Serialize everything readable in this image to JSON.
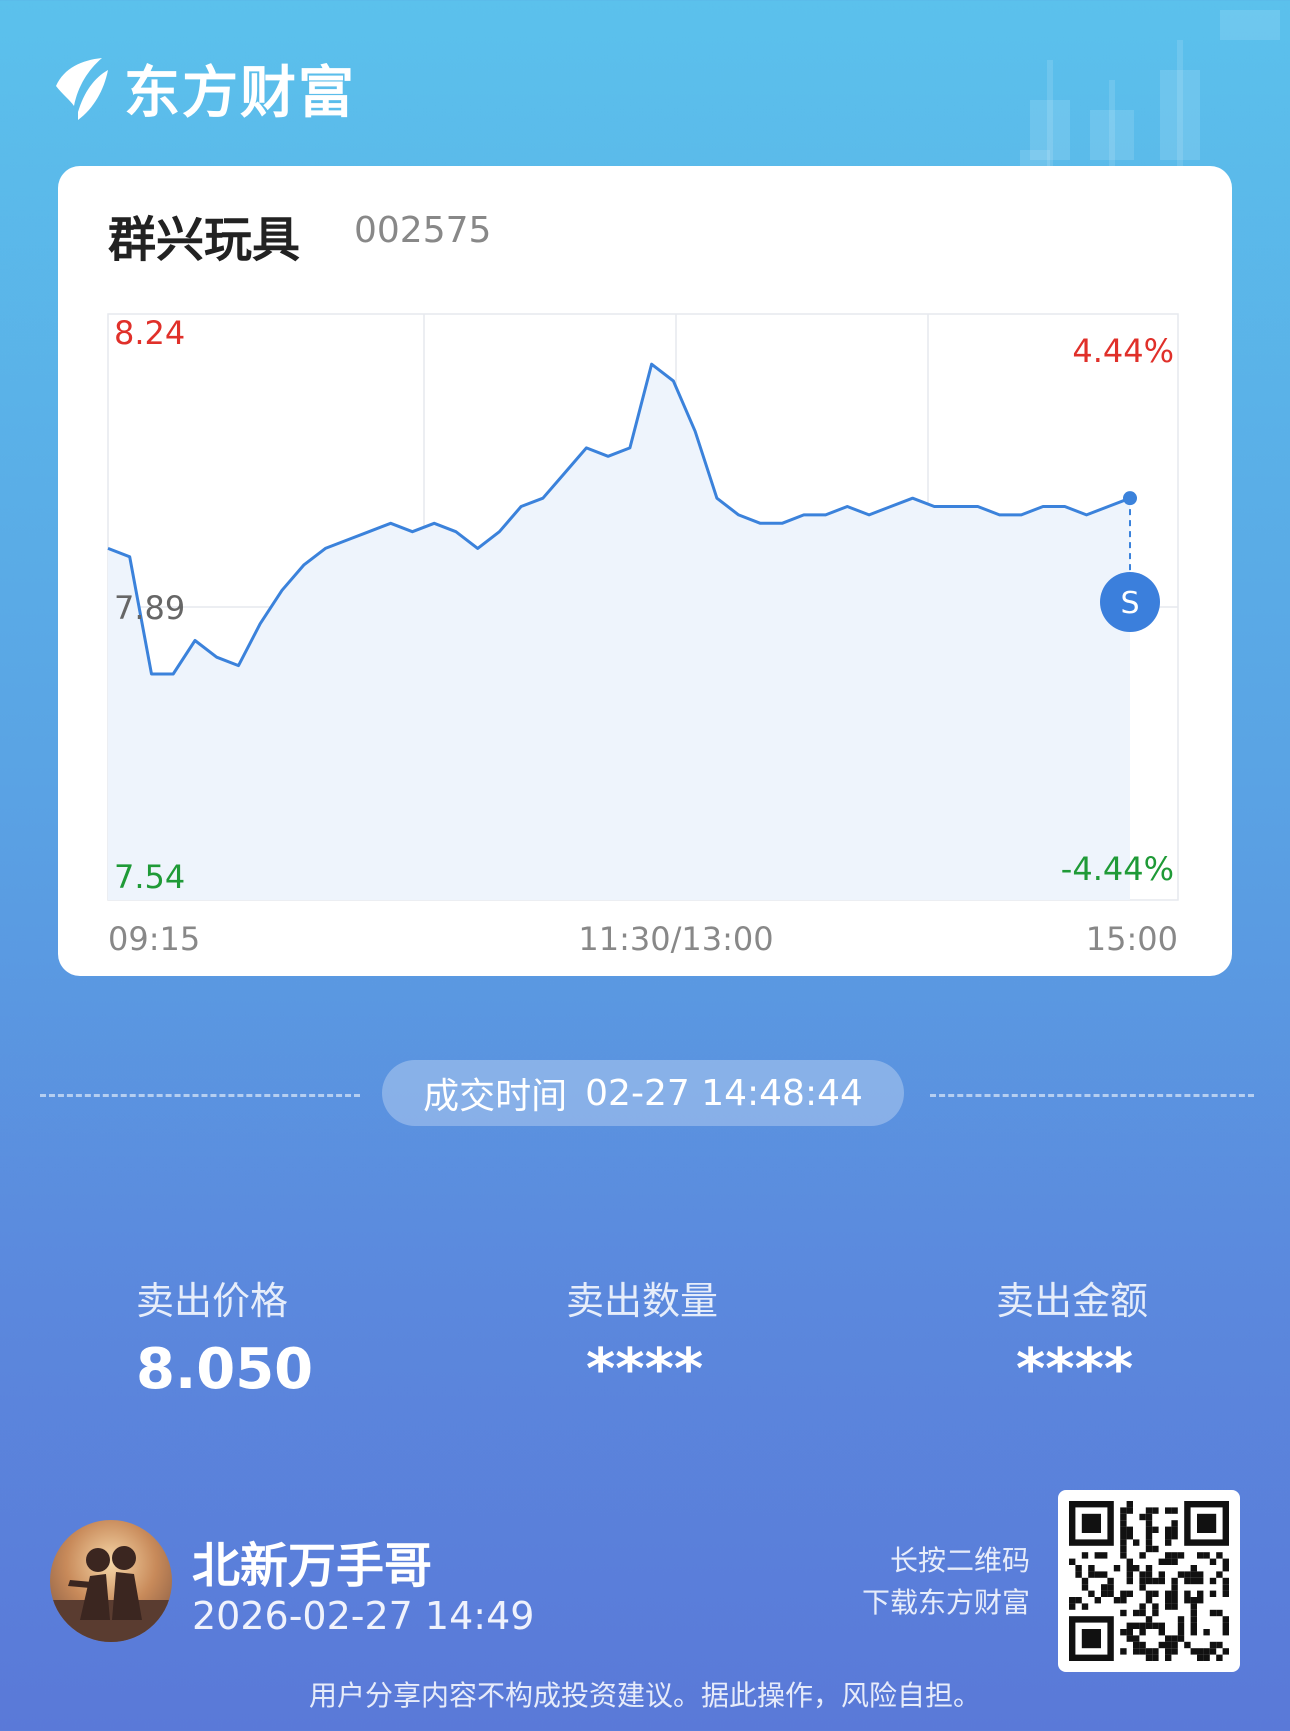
{
  "app": {
    "brand": "东方财富"
  },
  "stock": {
    "name": "群兴玩具",
    "code": "002575"
  },
  "chart_data": {
    "type": "line",
    "title": "",
    "price_high": "8.24",
    "price_base": "7.89",
    "price_low": "7.54",
    "pct_high": "4.44%",
    "pct_low": "-4.44%",
    "x_ticks": [
      "09:15",
      "11:30/13:00",
      "15:00"
    ],
    "ylim": [
      7.54,
      8.24
    ],
    "sell_marker_label": "S",
    "x": [
      "09:30",
      "09:35",
      "09:40",
      "09:45",
      "09:50",
      "09:55",
      "10:00",
      "10:05",
      "10:10",
      "10:15",
      "10:20",
      "10:25",
      "10:30",
      "10:35",
      "10:40",
      "10:45",
      "10:50",
      "10:55",
      "11:00",
      "11:05",
      "11:10",
      "11:15",
      "11:20",
      "11:25",
      "11:30",
      "13:05",
      "13:10",
      "13:15",
      "13:20",
      "13:25",
      "13:30",
      "13:35",
      "13:40",
      "13:45",
      "13:50",
      "13:55",
      "14:00",
      "14:05",
      "14:10",
      "14:15",
      "14:20",
      "14:25",
      "14:30",
      "14:35",
      "14:40",
      "14:45",
      "14:48",
      "14:50"
    ],
    "series": [
      {
        "values": [
          7.96,
          7.95,
          7.81,
          7.81,
          7.85,
          7.83,
          7.82,
          7.87,
          7.91,
          7.94,
          7.96,
          7.97,
          7.98,
          7.99,
          7.98,
          7.99,
          7.98,
          7.96,
          7.98,
          8.01,
          8.02,
          8.05,
          8.08,
          8.07,
          8.08,
          8.18,
          8.16,
          8.1,
          8.02,
          8.0,
          7.99,
          7.99,
          8.0,
          8.0,
          8.01,
          8.0,
          8.01,
          8.02,
          8.01,
          8.01,
          8.01,
          8.0,
          8.0,
          8.01,
          8.01,
          8.0,
          8.01,
          8.02
        ]
      }
    ]
  },
  "trade": {
    "time_label": "成交时间",
    "time_value": "02-27 14:48:44"
  },
  "stats": [
    {
      "label": "卖出价格",
      "value": "8.050"
    },
    {
      "label": "卖出数量",
      "value": "****"
    },
    {
      "label": "卖出金额",
      "value": "****"
    }
  ],
  "user": {
    "name": "北新万手哥",
    "time": "2026-02-27 14:49"
  },
  "qr": {
    "line1": "长按二维码",
    "line2": "下载东方财富"
  },
  "disclaimer": "用户分享内容不构成投资建议。据此操作，风险自担。",
  "colors": {
    "up": "#e0302a",
    "down": "#1f9a37",
    "line": "#3b82db",
    "fill": "#eef4fc"
  }
}
